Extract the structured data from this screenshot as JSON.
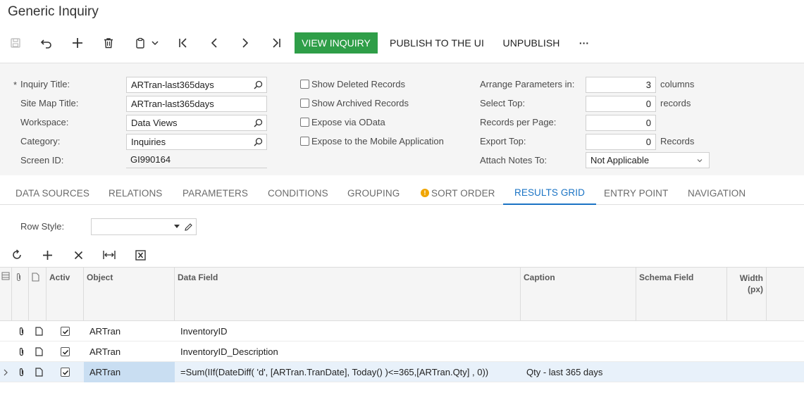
{
  "page": {
    "title": "Generic Inquiry"
  },
  "toolbar": {
    "view_inquiry": "VIEW INQUIRY",
    "publish": "PUBLISH TO THE UI",
    "unpublish": "UNPUBLISH",
    "more": "···"
  },
  "form": {
    "inquiry_title": {
      "label": "Inquiry Title:",
      "value": "ARTran-last365days",
      "required_mark": "*"
    },
    "site_map_title": {
      "label": "Site Map Title:",
      "value": "ARTran-last365days"
    },
    "workspace": {
      "label": "Workspace:",
      "value": "Data Views"
    },
    "category": {
      "label": "Category:",
      "value": "Inquiries"
    },
    "screen_id": {
      "label": "Screen ID:",
      "value": "GI990164"
    },
    "show_deleted": {
      "label": "Show Deleted Records",
      "checked": false
    },
    "show_archived": {
      "label": "Show Archived Records",
      "checked": false
    },
    "expose_odata": {
      "label": "Expose via OData",
      "checked": false
    },
    "expose_mobile": {
      "label": "Expose to the Mobile Application",
      "checked": false
    },
    "arrange_params": {
      "label": "Arrange Parameters in:",
      "value": "3",
      "unit": "columns"
    },
    "select_top": {
      "label": "Select Top:",
      "value": "0",
      "unit": "records"
    },
    "records_per_page": {
      "label": "Records per Page:",
      "value": "0"
    },
    "export_top": {
      "label": "Export Top:",
      "value": "0",
      "unit": "Records"
    },
    "attach_notes": {
      "label": "Attach Notes To:",
      "value": "Not Applicable"
    }
  },
  "tabs": [
    {
      "label": "DATA SOURCES"
    },
    {
      "label": "RELATIONS"
    },
    {
      "label": "PARAMETERS"
    },
    {
      "label": "CONDITIONS"
    },
    {
      "label": "GROUPING"
    },
    {
      "label": "SORT ORDER",
      "warning": true
    },
    {
      "label": "RESULTS GRID",
      "active": true
    },
    {
      "label": "ENTRY POINT"
    },
    {
      "label": "NAVIGATION"
    }
  ],
  "results": {
    "row_style_label": "Row Style:",
    "row_style_value": "",
    "columns": {
      "active": "Activ",
      "object": "Object",
      "data_field": "Data Field",
      "caption": "Caption",
      "schema_field": "Schema Field",
      "width": "Width (px)"
    },
    "rows": [
      {
        "active": true,
        "object": "ARTran",
        "data_field": "InventoryID",
        "caption": ""
      },
      {
        "active": true,
        "object": "ARTran",
        "data_field": "InventoryID_Description",
        "caption": ""
      },
      {
        "active": true,
        "object": "ARTran",
        "data_field": "=Sum(IIf(DateDiff( 'd', [ARTran.TranDate], Today() )<=365,[ARTran.Qty] , 0))",
        "caption": "Qty - last 365 days",
        "selected": true
      }
    ]
  },
  "colors": {
    "primary_button": "#2f9e48",
    "active_tab": "#1a73c4",
    "warning": "#f0a500"
  }
}
